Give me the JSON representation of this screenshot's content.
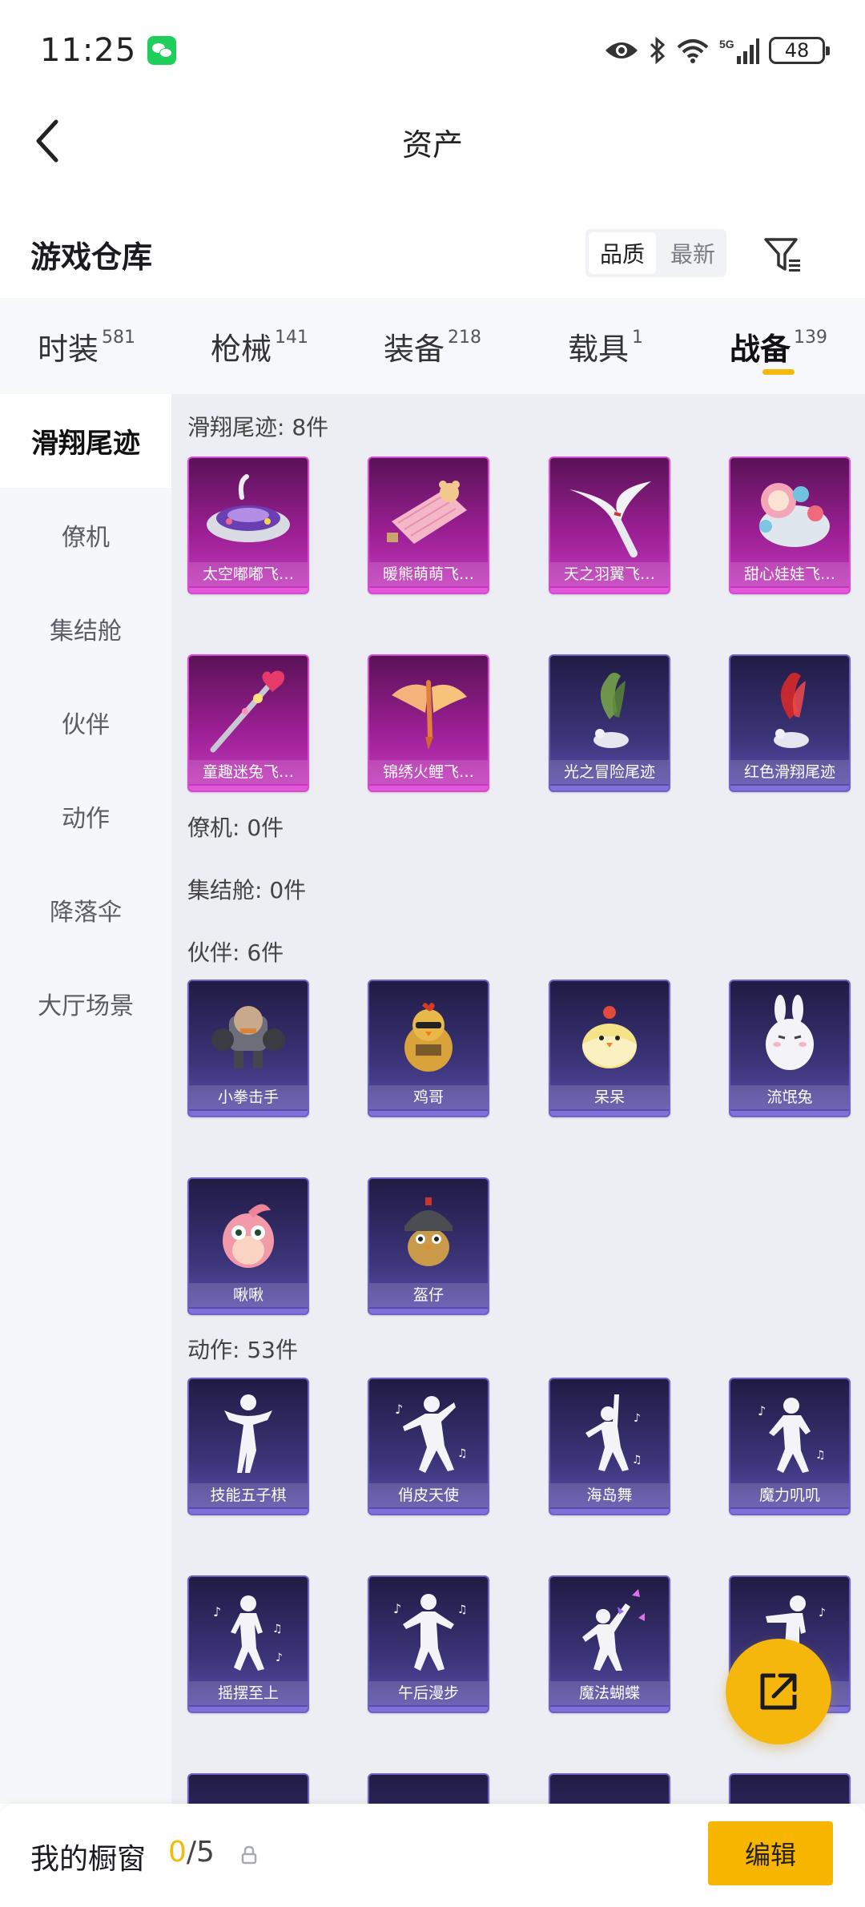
{
  "status_bar": {
    "time": "11:25",
    "battery": "48",
    "network": "5G"
  },
  "header": {
    "title": "资产"
  },
  "warehouse": {
    "title": "游戏仓库",
    "sort_options": [
      "品质",
      "最新"
    ],
    "active_sort": "品质"
  },
  "tabs": [
    {
      "label": "时装",
      "count": "581"
    },
    {
      "label": "枪械",
      "count": "141"
    },
    {
      "label": "装备",
      "count": "218"
    },
    {
      "label": "载具",
      "count": "1"
    },
    {
      "label": "战备",
      "count": "139"
    }
  ],
  "active_tab": "战备",
  "sidebar": {
    "items": [
      {
        "label": "滑翔尾迹"
      },
      {
        "label": "僚机"
      },
      {
        "label": "集结舱"
      },
      {
        "label": "伙伴"
      },
      {
        "label": "动作"
      },
      {
        "label": "降落伞"
      },
      {
        "label": "大厅场景"
      }
    ]
  },
  "sections": {
    "glide": {
      "heading": "滑翔尾迹: 8件",
      "items": [
        {
          "name": "太空嘟嘟飞…",
          "icon": "space-saucer-icon"
        },
        {
          "name": "暖熊萌萌飞…",
          "icon": "bear-blanket-icon"
        },
        {
          "name": "天之羽翼飞…",
          "icon": "feather-wing-icon"
        },
        {
          "name": "甜心娃娃飞…",
          "icon": "sweet-doll-icon"
        },
        {
          "name": "童趣迷兔飞…",
          "icon": "magic-wand-icon"
        },
        {
          "name": "锦绣火鲤飞…",
          "icon": "fire-koi-icon"
        },
        {
          "name": "光之冒险尾迹",
          "icon": "green-smoke-icon"
        },
        {
          "name": "红色滑翔尾迹",
          "icon": "red-smoke-icon"
        }
      ]
    },
    "wingman": {
      "heading": "僚机: 0件"
    },
    "pod": {
      "heading": "集结舱: 0件"
    },
    "partner": {
      "heading": "伙伴: 6件",
      "items": [
        {
          "name": "小拳击手",
          "icon": "boxer-robot-icon"
        },
        {
          "name": "鸡哥",
          "icon": "chicken-icon"
        },
        {
          "name": "呆呆",
          "icon": "chick-icon"
        },
        {
          "name": "流氓兔",
          "icon": "rabbit-icon"
        },
        {
          "name": "啾啾",
          "icon": "pink-bird-icon"
        },
        {
          "name": "盔仔",
          "icon": "helmet-chick-icon"
        }
      ]
    },
    "emote": {
      "heading": "动作: 53件",
      "items": [
        {
          "name": "技能五子棋",
          "icon": "dance-pose-icon"
        },
        {
          "name": "俏皮天使",
          "icon": "dance-pose-icon"
        },
        {
          "name": "海岛舞",
          "icon": "dance-pose-icon"
        },
        {
          "name": "魔力叽叽",
          "icon": "dance-pose-icon"
        },
        {
          "name": "摇摆至上",
          "icon": "dance-pose-icon"
        },
        {
          "name": "午后漫步",
          "icon": "dance-pose-icon"
        },
        {
          "name": "魔法蝴蝶",
          "icon": "butterfly-dance-icon"
        },
        {
          "name": "",
          "icon": "dance-pose-icon"
        }
      ]
    }
  },
  "showcase": {
    "label": "我的橱窗",
    "current": "0",
    "total": "/5"
  },
  "edit_button": "编辑",
  "colors": {
    "accent": "#f5b90a",
    "purple_card": "#9b1f93",
    "blue_card": "#3b3478"
  }
}
